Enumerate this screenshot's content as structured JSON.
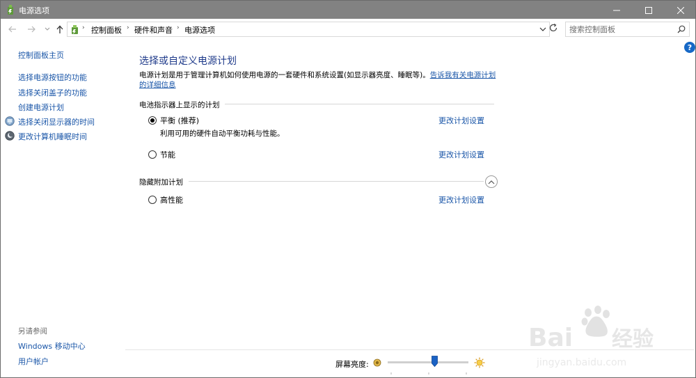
{
  "window": {
    "title": "电源选项"
  },
  "address": {
    "crumbs": [
      "控制面板",
      "硬件和声音",
      "电源选项"
    ]
  },
  "search": {
    "placeholder": "搜索控制面板"
  },
  "sidebar": {
    "home": "控制面板主页",
    "items": [
      {
        "label": "选择电源按钮的功能",
        "icon": null
      },
      {
        "label": "选择关闭盖子的功能",
        "icon": null
      },
      {
        "label": "创建电源计划",
        "icon": null
      },
      {
        "label": "选择关闭显示器的时间",
        "icon": "monitor-icon"
      },
      {
        "label": "更改计算机睡眠时间",
        "icon": "moon-icon"
      }
    ],
    "see_also_title": "另请参阅",
    "see_also": [
      "Windows 移动中心",
      "用户帐户"
    ]
  },
  "main": {
    "title": "选择或自定义电源计划",
    "description": "电源计划是用于管理计算机如何使用电源的一套硬件和系统设置(如显示器亮度、睡眠等)。",
    "learn_more": "告诉我有关电源计划的详细信息",
    "section_battery": "电池指示器上显示的计划",
    "section_hidden": "隐藏附加计划",
    "plans": [
      {
        "name": "平衡 (推荐)",
        "desc": "利用可用的硬件自动平衡功耗与性能。",
        "selected": true,
        "change": "更改计划设置"
      },
      {
        "name": "节能",
        "desc": "",
        "selected": false,
        "change": "更改计划设置"
      },
      {
        "name": "高性能",
        "desc": "",
        "selected": false,
        "change": "更改计划设置"
      }
    ]
  },
  "brightness": {
    "label": "屏幕亮度:",
    "level": 0.58
  },
  "colors": {
    "link": "#1a56a8",
    "title": "#1e3a8a",
    "titlebar": "#828282",
    "accent": "#1668c6"
  }
}
